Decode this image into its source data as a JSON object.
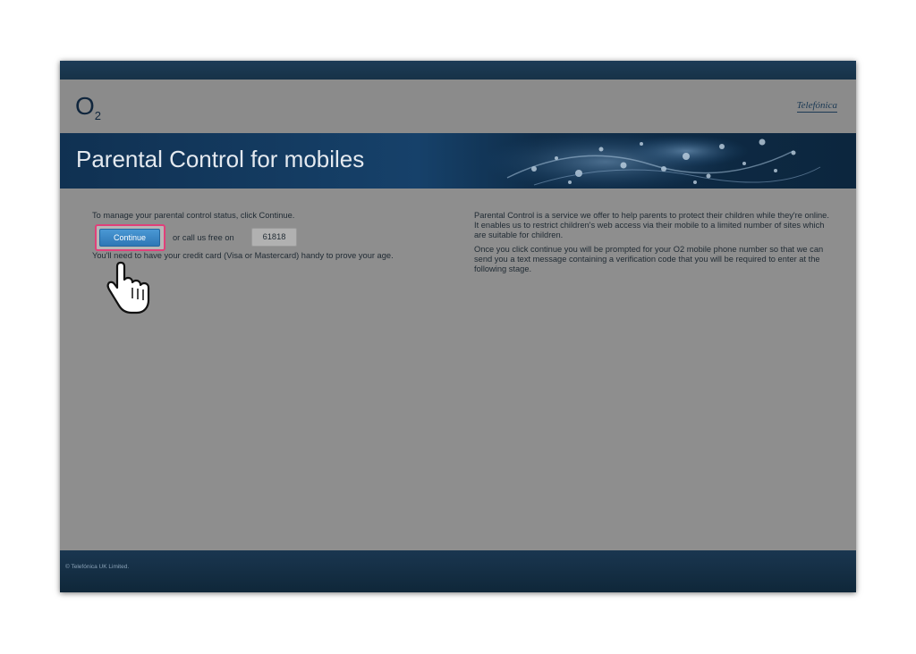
{
  "brand": {
    "logo": "O",
    "logo_sub": "2",
    "partner": "Telefónica"
  },
  "banner": {
    "title": "Parental Control for mobiles"
  },
  "left": {
    "intro": "To manage your parental control status, click Continue.",
    "continue_label": "Continue",
    "call_text": "or call us free on",
    "phone_number": "61818",
    "note": "You'll need to have your credit card (Visa or Mastercard) handy to prove your age."
  },
  "right": {
    "paragraph1": "Parental Control is a service we offer to help parents to protect their children while they're online. It enables us to restrict children's web access via their mobile to a limited number of sites which are suitable for children.",
    "paragraph2": "Once you click continue you will be prompted for your O2 mobile phone number so that we can send you a text message containing a verification code that you will be required to enter at the following stage."
  },
  "footer": {
    "copyright": "© Telefónica UK Limited."
  },
  "colors": {
    "accent_highlight": "#e0407a",
    "button_blue": "#3a87c6",
    "banner_navy": "#103152"
  }
}
